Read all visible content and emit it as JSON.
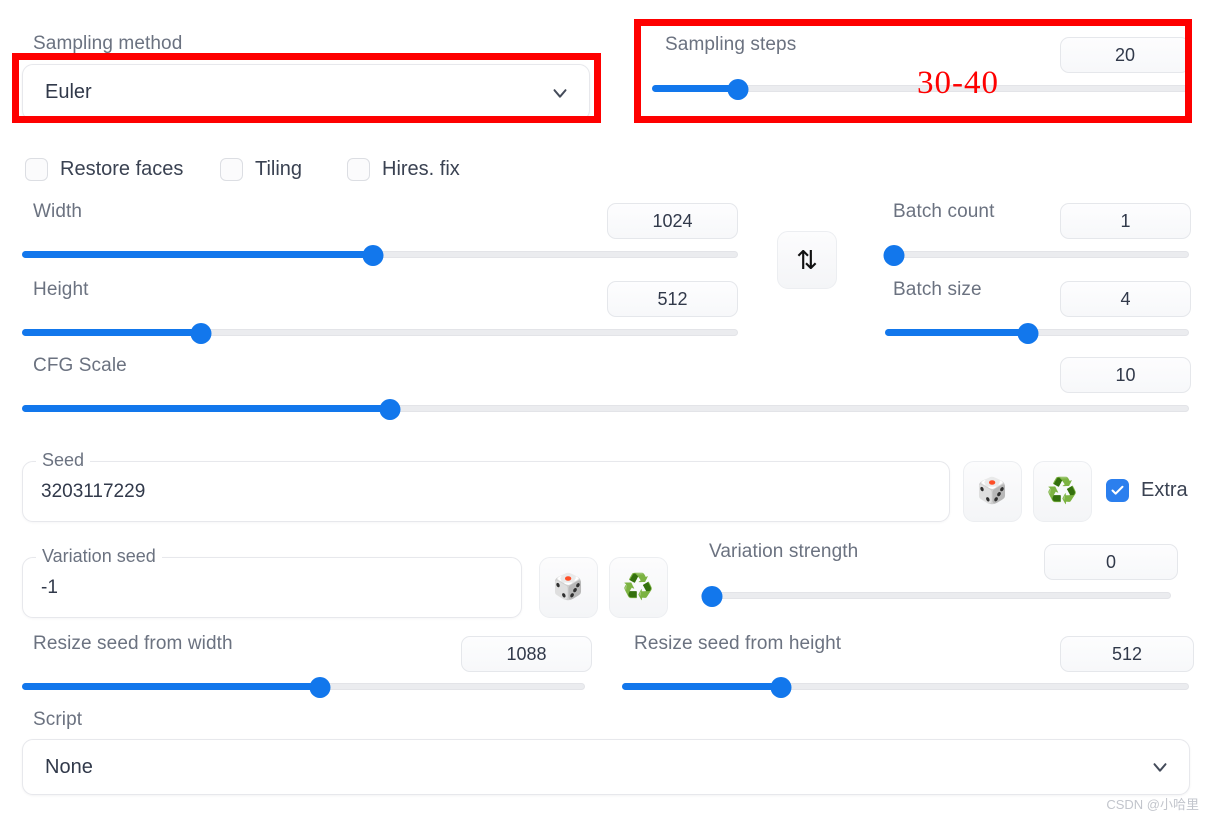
{
  "sampling_method": {
    "label": "Sampling method",
    "value": "Euler",
    "chevron_icon": "chevron-down-icon"
  },
  "sampling_steps": {
    "label": "Sampling steps",
    "value": "20",
    "slider_percent": 16
  },
  "annotations": {
    "steps_note": "30-40"
  },
  "toggles": [
    {
      "label": "Restore faces",
      "checked": false
    },
    {
      "label": "Tiling",
      "checked": false
    },
    {
      "label": "Hires. fix",
      "checked": false
    }
  ],
  "width": {
    "label": "Width",
    "value": "1024",
    "slider_percent": 49
  },
  "height": {
    "label": "Height",
    "value": "512",
    "slider_percent": 25
  },
  "swap_button": {
    "icon": "swap-vertical-icon",
    "glyph": "⇅"
  },
  "batch_count": {
    "label": "Batch count",
    "value": "1",
    "slider_percent": 0
  },
  "batch_size": {
    "label": "Batch size",
    "value": "4",
    "slider_percent": 47
  },
  "cfg_scale": {
    "label": "CFG Scale",
    "value": "10",
    "slider_percent": 31
  },
  "seed": {
    "label": "Seed",
    "value": "3203117229",
    "dice_icon": "dice-icon",
    "dice_glyph": "🎲",
    "recycle_icon": "recycle-icon",
    "recycle_glyph": "♻️",
    "extra_label": "Extra",
    "extra_checked": true
  },
  "variation_seed": {
    "label": "Variation seed",
    "value": "-1",
    "dice_icon": "dice-icon",
    "dice_glyph": "🎲",
    "recycle_icon": "recycle-icon",
    "recycle_glyph": "♻️"
  },
  "variation_strength": {
    "label": "Variation strength",
    "value": "0",
    "slider_percent": 1
  },
  "resize_seed_from_width": {
    "label": "Resize seed from width",
    "value": "1088",
    "slider_percent": 53
  },
  "resize_seed_from_height": {
    "label": "Resize seed from height",
    "value": "512",
    "slider_percent": 28
  },
  "script": {
    "label": "Script",
    "value": "None",
    "chevron_icon": "chevron-down-icon"
  },
  "watermark": {
    "text": "CSDN @小哈里"
  },
  "colors": {
    "accent": "#1277ec",
    "annotation": "#fe0000",
    "label": "#6b7280",
    "track": "#ebecef"
  }
}
